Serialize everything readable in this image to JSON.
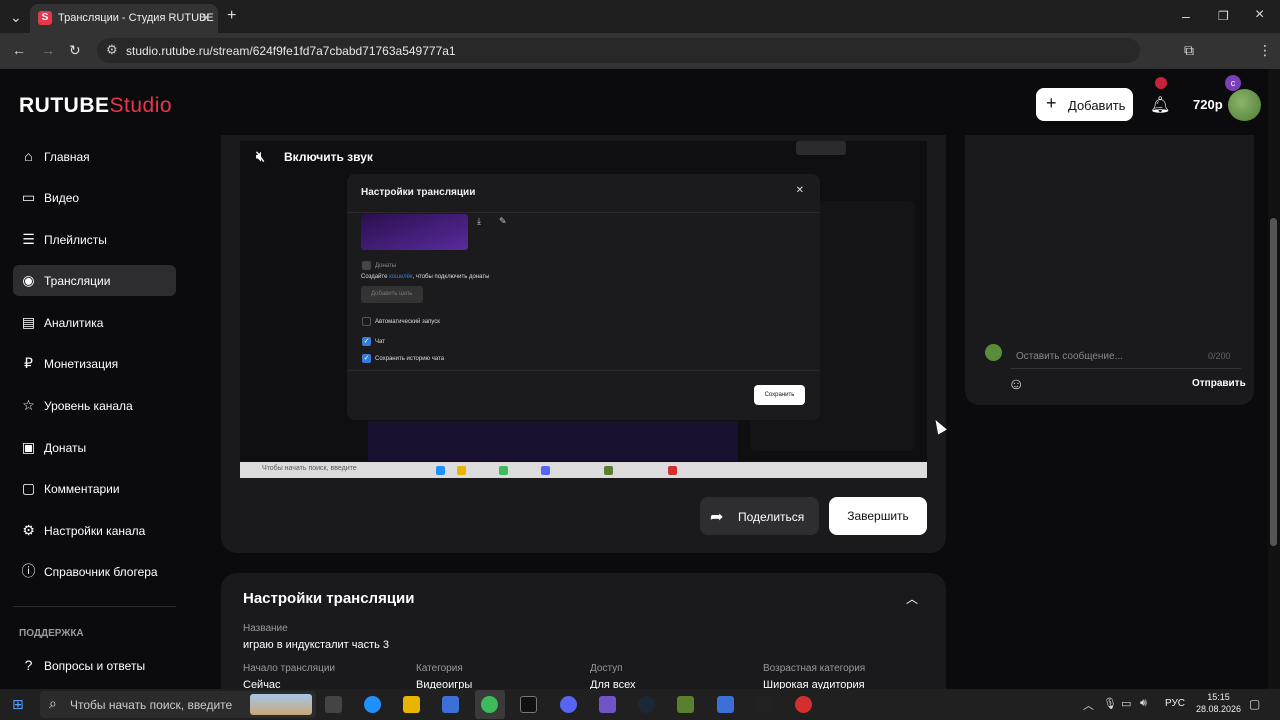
{
  "browser": {
    "tab_title": "Трансляции - Студия RUTUBE",
    "tab_favicon": "S",
    "url": "studio.rutube.ru/stream/624f9fe1fd7a7cbabd71763a549777a1"
  },
  "header": {
    "logo_main": "RUTUBE",
    "logo_studio": "Studio",
    "add_label": "Добавить",
    "quality": "720p"
  },
  "sidebar": {
    "items": [
      {
        "label": "Главная",
        "icon": "home-icon"
      },
      {
        "label": "Видео",
        "icon": "video-icon"
      },
      {
        "label": "Плейлисты",
        "icon": "playlist-icon"
      },
      {
        "label": "Трансляции",
        "icon": "broadcast-icon"
      },
      {
        "label": "Аналитика",
        "icon": "analytics-icon"
      },
      {
        "label": "Монетизация",
        "icon": "monetization-icon"
      },
      {
        "label": "Уровень канала",
        "icon": "star-icon"
      },
      {
        "label": "Донаты",
        "icon": "wallet-icon"
      },
      {
        "label": "Комментарии",
        "icon": "comment-icon"
      },
      {
        "label": "Настройки канала",
        "icon": "gear-icon"
      },
      {
        "label": "Справочник блогера",
        "icon": "info-icon"
      }
    ],
    "support_title": "ПОДДЕРЖКА",
    "support_items": [
      {
        "label": "Вопросы и ответы",
        "icon": "question-icon"
      }
    ]
  },
  "player": {
    "mute_label": "Включить звук",
    "embedded_modal": {
      "title": "Настройки трансляции",
      "donate": "Донаты",
      "donate_hint_a": "Создайте",
      "donate_hint_link": "кошелёк",
      "donate_hint_b": ", чтобы подключить донаты",
      "add_goal": "Добавить цель",
      "auto_start": "Автоматический запуск",
      "chat": "Чат",
      "save_history": "Сохранить историю чата",
      "save": "Сохранить"
    },
    "mini_search": "Чтобы начать поиск, введите"
  },
  "actions": {
    "share": "Поделиться",
    "end": "Завершить"
  },
  "chat": {
    "placeholder": "Оставить сообщение...",
    "counter": "0/200",
    "send": "Отправить"
  },
  "settings": {
    "title": "Настройки трансляции",
    "name_label": "Название",
    "name_value": "играю в индукcталит часть 3",
    "fields": [
      {
        "label": "Начало трансляции",
        "value": "Сейчас"
      },
      {
        "label": "Категория",
        "value": "Видеоигры"
      },
      {
        "label": "Доступ",
        "value": "Для всех"
      },
      {
        "label": "Возрастная категория",
        "value": "Широкая аудитория"
      }
    ]
  },
  "taskbar": {
    "search_placeholder": "Чтобы начать поиск, введите",
    "lang": "РУС",
    "time": "15:15",
    "date": "28.08.2026"
  },
  "colors": {
    "accent": "#e8364a",
    "background": "#0b0b0d",
    "card": "#1a1a1c",
    "active_nav": "#2d2d30"
  }
}
